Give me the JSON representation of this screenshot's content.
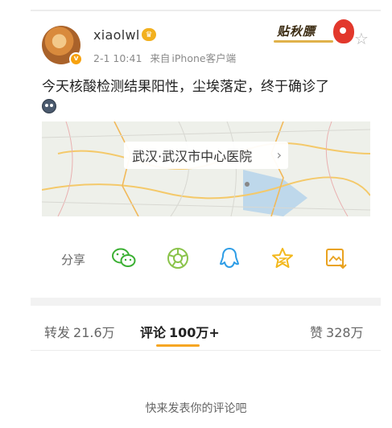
{
  "post": {
    "username": "xiaolwl",
    "member_badge_icon": "member-crown-icon",
    "verified_badge_icon": "v-badge-icon",
    "verified_badge_text": "v",
    "time": "2-1 10:41",
    "source_prefix": "来自",
    "source": "iPhone客户端",
    "sticker_text": "贴秋膘",
    "content": "今天核酸检测结果阳性，尘埃落定，终于确诊了",
    "emoji_icon": "sad-face-emoji-icon"
  },
  "location": {
    "label": "武汉·武汉市中心医院",
    "arrow": "›"
  },
  "share": {
    "label": "分享",
    "targets": [
      {
        "icon": "wechat-icon",
        "color": "#3cb034"
      },
      {
        "icon": "moments-icon",
        "color": "#8ac34a"
      },
      {
        "icon": "qq-icon",
        "color": "#2e9de6"
      },
      {
        "icon": "qzone-star-icon",
        "color": "#f3b81c"
      },
      {
        "icon": "save-image-icon",
        "color": "#e9a21f"
      }
    ]
  },
  "tabs": {
    "repost_label": "转发",
    "repost_count": "21.6万",
    "comment_label": "评论",
    "comment_count": "100万+",
    "like_label": "赞",
    "like_count": "328万"
  },
  "comment_placeholder": "快来发表你的评论吧",
  "colors": {
    "accent": "#f6a623",
    "text_primary": "#222222",
    "text_secondary": "#8a8a8a"
  }
}
